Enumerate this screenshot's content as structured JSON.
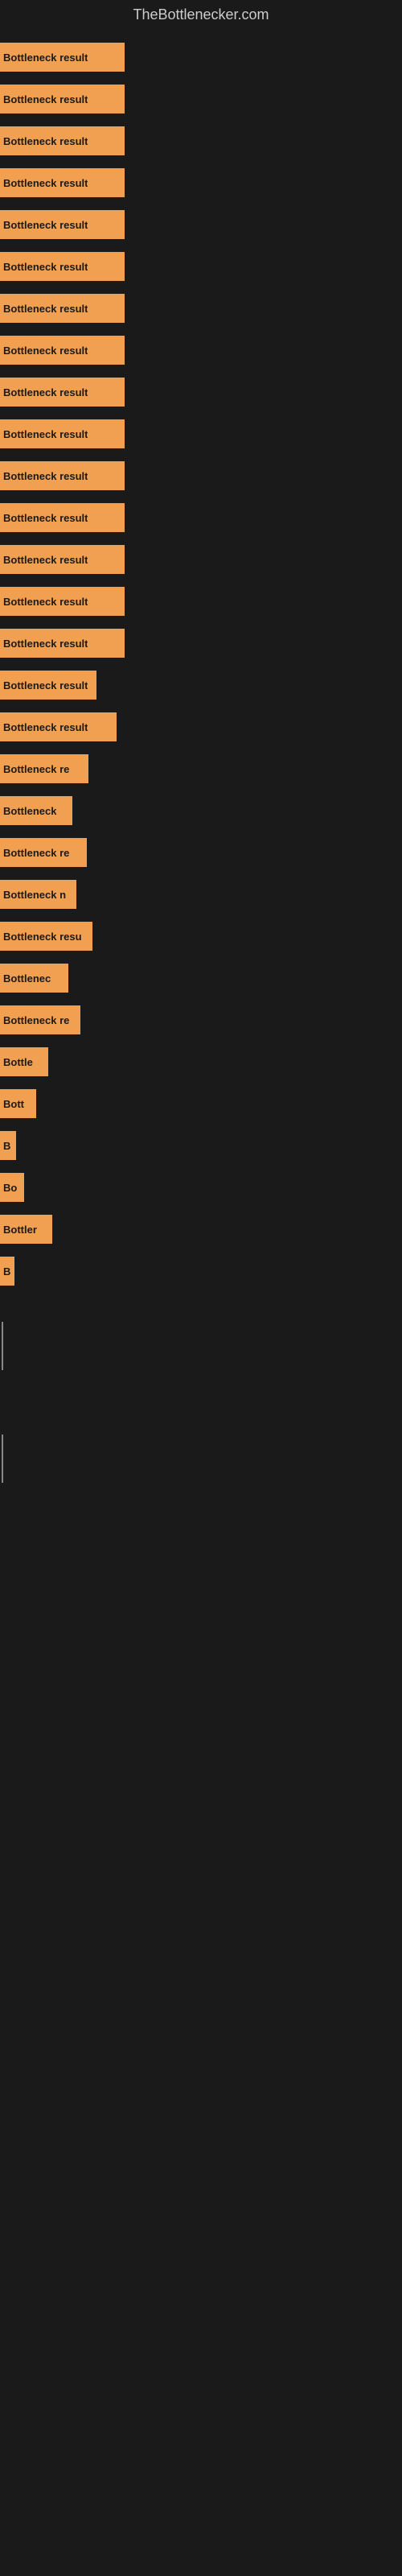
{
  "site": {
    "title": "TheBottlenecker.com"
  },
  "bars": [
    {
      "label": "Bottleneck result",
      "width": 155
    },
    {
      "label": "Bottleneck result",
      "width": 155
    },
    {
      "label": "Bottleneck result",
      "width": 155
    },
    {
      "label": "Bottleneck result",
      "width": 155
    },
    {
      "label": "Bottleneck result",
      "width": 155
    },
    {
      "label": "Bottleneck result",
      "width": 155
    },
    {
      "label": "Bottleneck result",
      "width": 155
    },
    {
      "label": "Bottleneck result",
      "width": 155
    },
    {
      "label": "Bottleneck result",
      "width": 155
    },
    {
      "label": "Bottleneck result",
      "width": 155
    },
    {
      "label": "Bottleneck result",
      "width": 155
    },
    {
      "label": "Bottleneck result",
      "width": 155
    },
    {
      "label": "Bottleneck result",
      "width": 155
    },
    {
      "label": "Bottleneck result",
      "width": 155
    },
    {
      "label": "Bottleneck result",
      "width": 155
    },
    {
      "label": "Bottleneck result",
      "width": 120
    },
    {
      "label": "Bottleneck result",
      "width": 145
    },
    {
      "label": "Bottleneck re",
      "width": 110
    },
    {
      "label": "Bottleneck",
      "width": 90
    },
    {
      "label": "Bottleneck re",
      "width": 108
    },
    {
      "label": "Bottleneck n",
      "width": 95
    },
    {
      "label": "Bottleneck resu",
      "width": 115
    },
    {
      "label": "Bottlenec",
      "width": 85
    },
    {
      "label": "Bottleneck re",
      "width": 100
    },
    {
      "label": "Bottle",
      "width": 60
    },
    {
      "label": "Bott",
      "width": 45
    },
    {
      "label": "B",
      "width": 20
    },
    {
      "label": "Bo",
      "width": 30
    },
    {
      "label": "Bottler",
      "width": 65
    },
    {
      "label": "B",
      "width": 18
    },
    {
      "label": "",
      "width": 0
    },
    {
      "label": "|",
      "width": 5
    },
    {
      "label": "",
      "width": 0
    },
    {
      "label": "",
      "width": 0
    },
    {
      "label": "",
      "width": 0
    },
    {
      "label": "|",
      "width": 5
    }
  ]
}
